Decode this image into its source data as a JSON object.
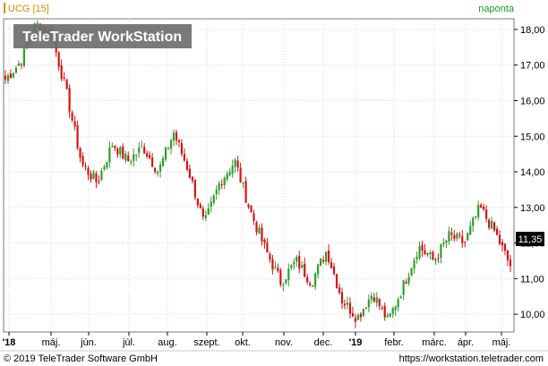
{
  "header": {
    "symbol": "UCG [15]",
    "period": "naponta",
    "watermark": "TeleTrader WorkStation"
  },
  "footer": {
    "copyright": "© 2019 TeleTrader Software GmbH",
    "url": "https://workstation.teletrader.com"
  },
  "colors": {
    "up": "#2e9e2e",
    "down": "#d21515",
    "grid": "#d6d6d6",
    "price_tag_bg": "#000000",
    "price_tag_text": "#ffffff",
    "period_text": "#1a9a1a",
    "symbol_text": "#e08a00",
    "watermark_bg": "#6b6b6b",
    "watermark_text": "#ffffff"
  },
  "chart_data": {
    "type": "candlestick",
    "grid": true,
    "y_axis_position": "right",
    "ylim": [
      9.5,
      18.3
    ],
    "yticks": [
      "10,00",
      "11,00",
      "12,00",
      "13,00",
      "14,00",
      "15,00",
      "16,00",
      "17,00",
      "18,00"
    ],
    "xticks": [
      "'18",
      "máj.",
      "jún.",
      "júl.",
      "aug.",
      "szept.",
      "okt.",
      "nov.",
      "dec.",
      "'19",
      "febr.",
      "márc.",
      "ápr.",
      "máj."
    ],
    "last_price": "11,35",
    "series": [
      {
        "close_anchors": [
          [
            "'18",
            16.6
          ],
          [
            "'18+",
            17.1
          ],
          [
            "ápr. közepe",
            18.15
          ],
          [
            "máj.",
            17.9
          ],
          [
            "máj. vége",
            16.2
          ],
          [
            "jún.",
            14.2
          ],
          [
            "jún. közepe",
            13.7
          ],
          [
            "jún. vége",
            14.8
          ],
          [
            "júl.",
            14.3
          ],
          [
            "júl. közepe",
            14.7
          ],
          [
            "júl. vége",
            14.0
          ],
          [
            "aug.",
            15.1
          ],
          [
            "aug. közepe",
            14.0
          ],
          [
            "szept.",
            12.5
          ],
          [
            "szept. közepe",
            13.7
          ],
          [
            "szept. vége",
            14.3
          ],
          [
            "okt.",
            12.9
          ],
          [
            "okt. közepe",
            11.8
          ],
          [
            "nov.",
            10.9
          ],
          [
            "nov. közepe",
            11.5
          ],
          [
            "nov. vége",
            10.9
          ],
          [
            "dec.",
            11.8
          ],
          [
            "dec. közepe",
            10.4
          ],
          [
            "'19",
            9.9
          ],
          [
            "jan. közepe",
            10.6
          ],
          [
            "febr.",
            9.8
          ],
          [
            "febr. közepe",
            10.8
          ],
          [
            "márc.",
            11.9
          ],
          [
            "márc. közepe",
            11.5
          ],
          [
            "ápr.",
            12.2
          ],
          [
            "ápr. közepe",
            12.0
          ],
          [
            "ápr. vége",
            13.0
          ],
          [
            "máj.",
            12.3
          ],
          [
            "máj. közepe",
            11.35
          ]
        ]
      }
    ]
  }
}
